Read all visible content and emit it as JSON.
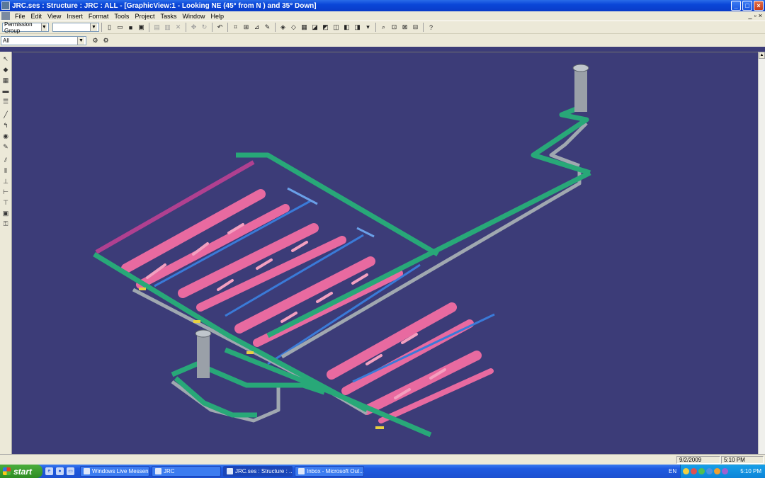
{
  "window": {
    "title": "JRC.ses : Structure : JRC : ALL - [GraphicView:1 - Looking NE (45° from N ) and 35° Down]",
    "controls": [
      "_",
      "□",
      "×"
    ]
  },
  "menu": {
    "items": [
      "File",
      "Edit",
      "View",
      "Insert",
      "Format",
      "Tools",
      "Project",
      "Tasks",
      "Window",
      "Help"
    ],
    "mdi_controls": [
      "_",
      "▫",
      "×"
    ]
  },
  "toolbar": {
    "permission_group": "Permission Group",
    "second_combo": "",
    "icons": [
      "new-icon",
      "open-icon",
      "save-icon",
      "print-preview-icon",
      "cut-icon",
      "copy-icon",
      "delete-icon",
      "move-icon",
      "rotate-icon",
      "undo-icon",
      "select-icon",
      "properties-icon",
      "measure-icon",
      "pencil-icon",
      "view1-icon",
      "view2-icon",
      "view3-icon",
      "view4-icon",
      "view5-icon",
      "view6-icon",
      "view7-icon",
      "view8-icon",
      "view9-icon",
      "zoom-icon",
      "zoom-area-icon",
      "fit-icon",
      "pan-icon",
      "help-icon"
    ]
  },
  "filter_bar": {
    "filter": "All"
  },
  "status": {
    "date": "9/2/2009",
    "time": "5:10 PM"
  },
  "taskbar": {
    "start": "start",
    "tasks": [
      {
        "label": "Windows Live Messen...",
        "active": false
      },
      {
        "label": "JRC",
        "active": false
      },
      {
        "label": "JRC.ses : Structure : ...",
        "active": true
      },
      {
        "label": "Inbox - Microsoft Out...",
        "active": false
      }
    ],
    "lang": "EN",
    "clock": "5:10 PM"
  },
  "colors": {
    "viewport_bg": "#3c3c78",
    "pipe_green": "#28a878",
    "pipe_pink": "#e86aa0",
    "pipe_grey": "#a0a8b0",
    "pipe_blue": "#3a7ad8"
  }
}
